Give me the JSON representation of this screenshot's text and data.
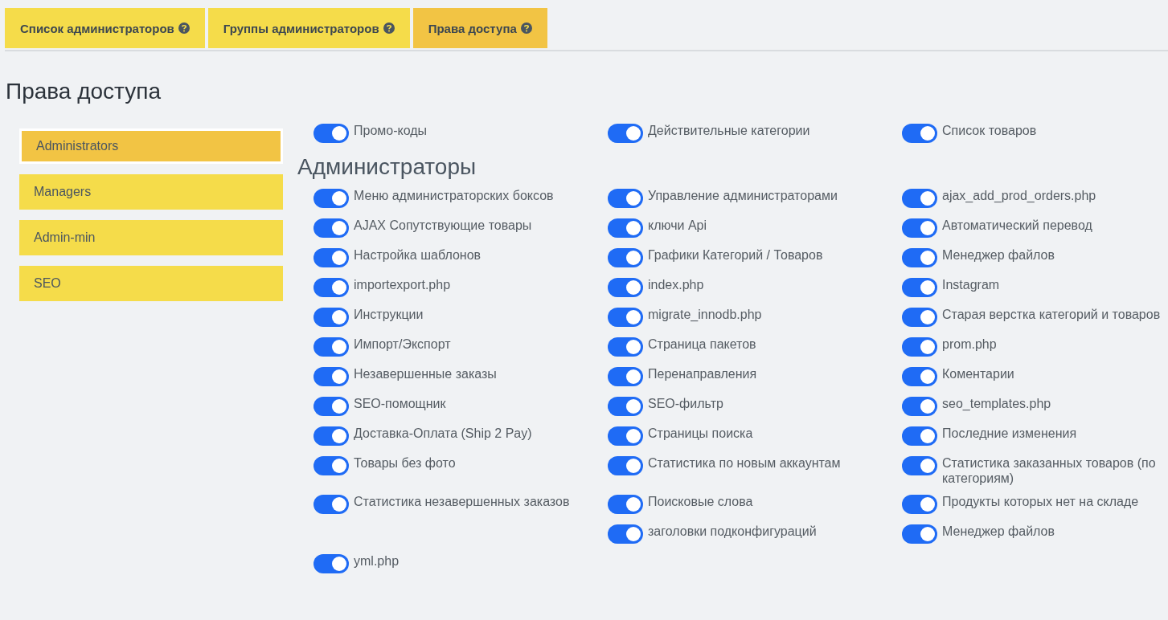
{
  "tabs": [
    {
      "label": "Список администраторов",
      "selected": false
    },
    {
      "label": "Группы администраторов",
      "selected": false
    },
    {
      "label": "Права доступа",
      "selected": true
    }
  ],
  "title": "Права доступа",
  "groups": [
    {
      "label": "Administrators",
      "selected": true
    },
    {
      "label": "Managers",
      "selected": false
    },
    {
      "label": "Admin-min",
      "selected": false
    },
    {
      "label": "SEO",
      "selected": false
    }
  ],
  "sections": [
    {
      "rows": [
        [
          {
            "label": "Промо-коды",
            "on": true
          },
          {
            "label": "Действительные категории",
            "on": true
          },
          {
            "label": "Список товаров",
            "on": true
          }
        ]
      ]
    },
    {
      "heading": "Администраторы",
      "rows": [
        [
          {
            "label": "Меню администраторских боксов",
            "on": true
          },
          {
            "label": "Управление администраторами",
            "on": true
          },
          {
            "label": "ajax_add_prod_orders.php",
            "on": true
          }
        ],
        [
          {
            "label": "AJAX Сопутствующие товары",
            "on": true
          },
          {
            "label": "ключи Api",
            "on": true
          },
          {
            "label": "Автоматический перевод",
            "on": true
          }
        ],
        [
          {
            "label": "Настройка шаблонов",
            "on": true
          },
          {
            "label": "Графики Категорий / Товаров",
            "on": true
          },
          {
            "label": "Менеджер файлов",
            "on": true
          }
        ],
        [
          {
            "label": "importexport.php",
            "on": true
          },
          {
            "label": "index.php",
            "on": true
          },
          {
            "label": "Instagram",
            "on": true
          }
        ],
        [
          {
            "label": "Инструкции",
            "on": true
          },
          {
            "label": "migrate_innodb.php",
            "on": true
          },
          {
            "label": "Старая верстка категорий и товаров",
            "on": true
          }
        ],
        [
          {
            "label": "Импорт/Экспорт",
            "on": true
          },
          {
            "label": "Страница пакетов",
            "on": true
          },
          {
            "label": "prom.php",
            "on": true
          }
        ],
        [
          {
            "label": "Незавершенные заказы",
            "on": true
          },
          {
            "label": "Перенаправления",
            "on": true
          },
          {
            "label": "Коментарии",
            "on": true
          }
        ],
        [
          {
            "label": "SEO-помощник",
            "on": true
          },
          {
            "label": "SEO-фильтр",
            "on": true
          },
          {
            "label": "seo_templates.php",
            "on": true
          }
        ],
        [
          {
            "label": "Доставка-Оплата (Ship 2 Pay)",
            "on": true
          },
          {
            "label": "Страницы поиска",
            "on": true
          },
          {
            "label": "Последние изменения",
            "on": true
          }
        ],
        [
          {
            "label": "Товары без фото",
            "on": true
          },
          {
            "label": "Статистика по новым аккаунтам",
            "on": true
          },
          {
            "label": "Статистика заказанных товаров (по категориям)",
            "on": true
          }
        ],
        [
          {
            "label": "Статистика незавершенных заказов",
            "on": true
          },
          {
            "label": "Поисковые слова",
            "on": true
          },
          {
            "label": "Продукты которых нет на складе",
            "on": true
          }
        ],
        [
          null,
          {
            "label": "заголовки подконфигураций",
            "on": true
          },
          {
            "label": "Менеджер файлов",
            "on": true
          }
        ],
        [
          {
            "label": "yml.php",
            "on": true
          },
          null,
          null
        ]
      ]
    }
  ]
}
